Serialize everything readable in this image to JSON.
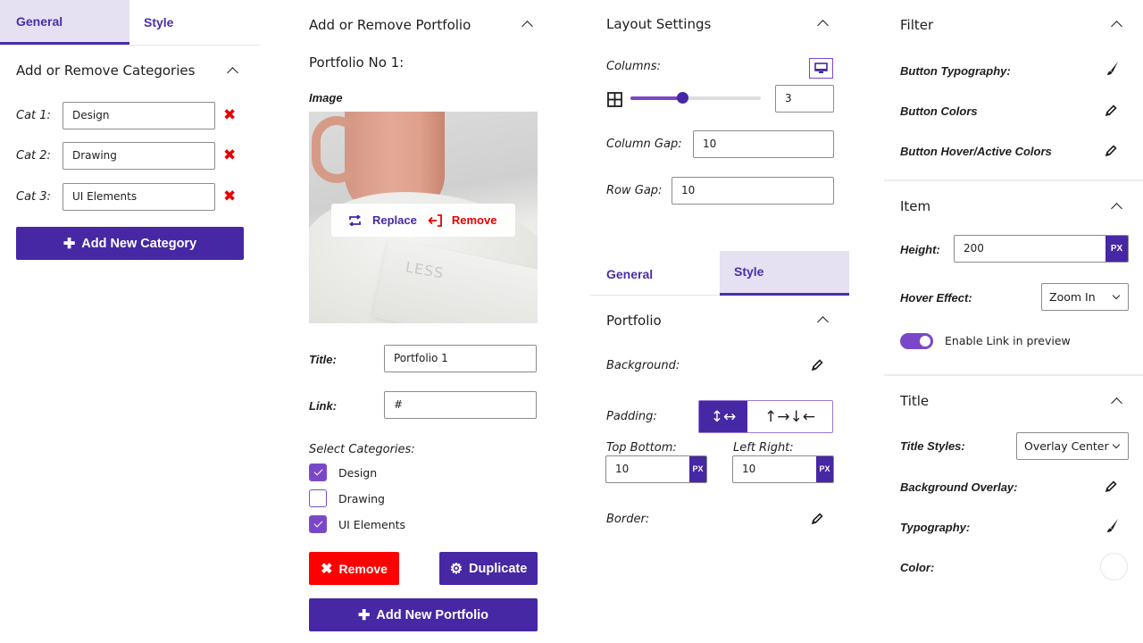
{
  "colors": {
    "accent": "#4627a4",
    "accent_light": "#7b47c9",
    "tab_active_bg": "#e5e1f3",
    "danger": "#ff0000"
  },
  "panel1": {
    "tabs": [
      {
        "label": "General",
        "active": true
      },
      {
        "label": "Style",
        "active": false
      }
    ],
    "section_title": "Add or Remove Categories",
    "categories": [
      {
        "label": "Cat 1:",
        "value": "Design"
      },
      {
        "label": "Cat 2:",
        "value": "Drawing"
      },
      {
        "label": "Cat 3:",
        "value": "UI Elements"
      }
    ],
    "delete_icon": "x-icon",
    "add_button": "Add New Category"
  },
  "panel2": {
    "section_title": "Add or Remove Portfolio",
    "portfolio_heading": "Portfolio No 1:",
    "image_label": "Image",
    "image_text": "LESS",
    "replace_label": "Replace",
    "remove_image_label": "Remove",
    "title_label": "Title:",
    "title_value": "Portfolio 1",
    "link_label": "Link:",
    "link_value": "#",
    "select_categories_label": "Select Categories:",
    "category_checks": [
      {
        "label": "Design",
        "checked": true
      },
      {
        "label": "Drawing",
        "checked": false
      },
      {
        "label": "UI Elements",
        "checked": true
      }
    ],
    "remove_button": "Remove",
    "duplicate_button": "Duplicate",
    "add_button": "Add New Portfolio"
  },
  "panel3": {
    "section_title": "Layout Settings",
    "columns_label": "Columns:",
    "columns_value": "3",
    "columns_slider_fraction": 0.4,
    "column_gap_label": "Column Gap:",
    "column_gap_value": "10",
    "row_gap_label": "Row Gap:",
    "row_gap_value": "10",
    "tabs": [
      {
        "label": "General",
        "active": false
      },
      {
        "label": "Style",
        "active": true
      }
    ],
    "portfolio_title": "Portfolio",
    "background_label": "Background:",
    "padding_label": "Padding:",
    "padding_modes": [
      {
        "glyph": "↕↔",
        "active": true
      },
      {
        "glyph": "↑→↓←",
        "active": false
      }
    ],
    "top_bottom_label": "Top Bottom:",
    "top_bottom_value": "10",
    "left_right_label": "Left Right:",
    "left_right_value": "10",
    "unit": "PX",
    "border_label": "Border:"
  },
  "panel4": {
    "filter_title": "Filter",
    "button_typography_label": "Button Typography:",
    "button_colors_label": "Button Colors",
    "button_hover_label": "Button Hover/Active Colors",
    "item_title": "Item",
    "height_label": "Height:",
    "height_value": "200",
    "unit": "PX",
    "hover_effect_label": "Hover Effect:",
    "hover_effect_value": "Zoom In",
    "enable_link_label": "Enable Link in preview",
    "enable_link_on": true,
    "title_section": "Title",
    "title_styles_label": "Title Styles:",
    "title_styles_value": "Overlay Center",
    "background_overlay_label": "Background Overlay:",
    "typography_label": "Typography:",
    "color_label": "Color:",
    "color_value": "#ffffff"
  }
}
